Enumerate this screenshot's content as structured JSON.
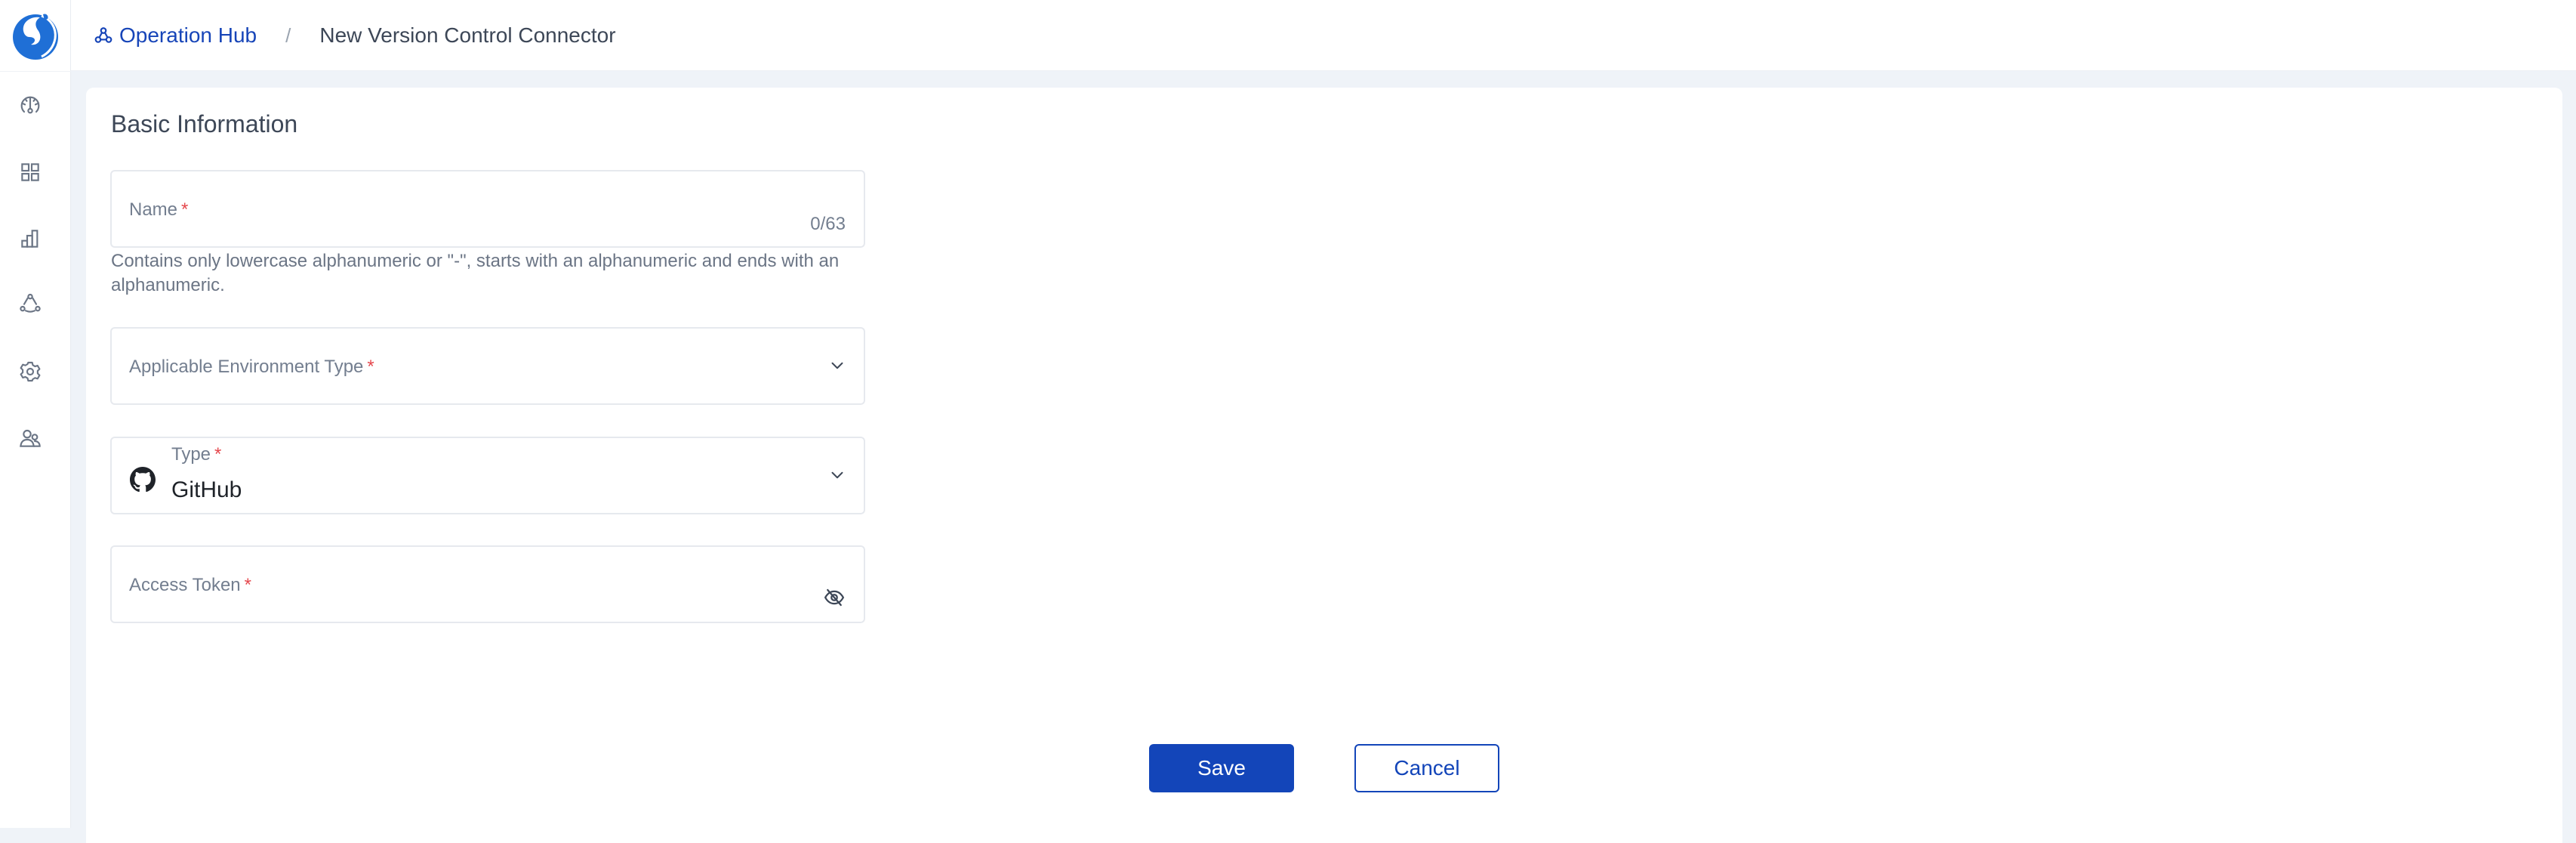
{
  "app": {
    "logo": "app-logo"
  },
  "sidebar": {
    "items": [
      {
        "icon": "dashboard-gauge-icon",
        "label": "Dashboard"
      },
      {
        "icon": "apps-grid-icon",
        "label": "Applications"
      },
      {
        "icon": "bar-chart-icon",
        "label": "Analytics"
      },
      {
        "icon": "connections-icon",
        "label": "Operation Hub"
      },
      {
        "icon": "gear-icon",
        "label": "Settings"
      },
      {
        "icon": "users-icon",
        "label": "Users"
      }
    ]
  },
  "breadcrumb": {
    "parent": "Operation Hub",
    "separator": "/",
    "current": "New Version Control Connector"
  },
  "form": {
    "section_title": "Basic Information",
    "name": {
      "label": "Name",
      "required_mark": "*",
      "value": "",
      "counter": "0/63",
      "helper": "Contains only lowercase alphanumeric or \"-\", starts with an alphanumeric and ends with an alphanumeric."
    },
    "environment_type": {
      "label": "Applicable Environment Type",
      "required_mark": "*",
      "value": ""
    },
    "type": {
      "label": "Type",
      "required_mark": "*",
      "value": "GitHub",
      "icon": "github-icon"
    },
    "access_token": {
      "label": "Access Token",
      "required_mark": "*",
      "value": "",
      "visibility_icon": "eye-off-icon"
    }
  },
  "actions": {
    "save_label": "Save",
    "cancel_label": "Cancel"
  },
  "colors": {
    "primary": "#1345b9",
    "link": "#1745b8",
    "required": "#e5484d",
    "logo": "#1f6fd6",
    "background": "#eff3f8"
  }
}
